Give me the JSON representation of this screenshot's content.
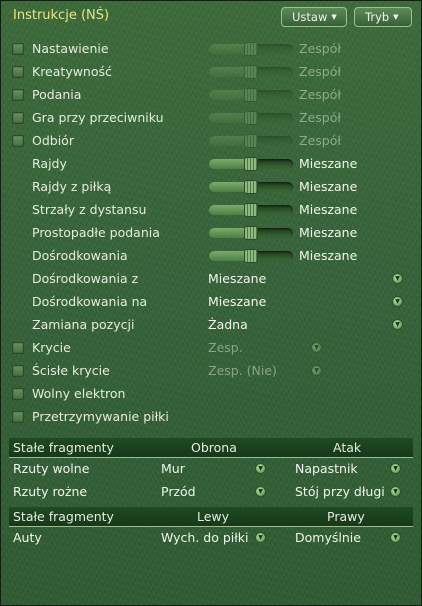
{
  "title": "Instrukcje (NŚ)",
  "buttons": {
    "set": "Ustaw",
    "mode": "Tryb"
  },
  "slider_rows": [
    {
      "label": "Nastawienie",
      "value": "Zespół",
      "level": 0.5,
      "enabled": false,
      "checkbox": true
    },
    {
      "label": "Kreatywność",
      "value": "Zespół",
      "level": 0.5,
      "enabled": false,
      "checkbox": true
    },
    {
      "label": "Podania",
      "value": "Zespół",
      "level": 0.5,
      "enabled": false,
      "checkbox": true
    },
    {
      "label": "Gra przy przeciwniku",
      "value": "Zespół",
      "level": 0.5,
      "enabled": false,
      "checkbox": true
    },
    {
      "label": "Odbiór",
      "value": "Zespół",
      "level": 0.5,
      "enabled": false,
      "checkbox": true
    },
    {
      "label": "Rajdy",
      "value": "Mieszane",
      "level": 0.5,
      "enabled": true,
      "checkbox": false
    },
    {
      "label": "Rajdy z piłką",
      "value": "Mieszane",
      "level": 0.5,
      "enabled": true,
      "checkbox": false
    },
    {
      "label": "Strzały z dystansu",
      "value": "Mieszane",
      "level": 0.5,
      "enabled": true,
      "checkbox": false
    },
    {
      "label": "Prostopadłe podania",
      "value": "Mieszane",
      "level": 0.5,
      "enabled": true,
      "checkbox": false
    },
    {
      "label": "Dośrodkowania",
      "value": "Mieszane",
      "level": 0.5,
      "enabled": true,
      "checkbox": false
    }
  ],
  "dropdown_rows": [
    {
      "label": "Dośrodkowania z",
      "value": "Mieszane"
    },
    {
      "label": "Dośrodkowania na",
      "value": "Mieszane"
    },
    {
      "label": "Zamiana pozycji",
      "value": "Żadna"
    }
  ],
  "check_dropdown_rows": [
    {
      "label": "Krycie",
      "value": "Zesp."
    },
    {
      "label": "Ścisłe krycie",
      "value": "Zesp. (Nie)"
    }
  ],
  "check_rows": [
    {
      "label": "Wolny elektron"
    },
    {
      "label": "Przetrzymywanie piłki"
    }
  ],
  "set_pieces_1": {
    "header": [
      "Stałe fragmenty",
      "Obrona",
      "Atak"
    ],
    "rows": [
      {
        "label": "Rzuty wolne",
        "defense": "Mur",
        "attack": "Napastnik"
      },
      {
        "label": "Rzuty rożne",
        "defense": "Przód",
        "attack": "Stój przy długi"
      }
    ]
  },
  "set_pieces_2": {
    "header": [
      "Stałe fragmenty",
      "Lewy",
      "Prawy"
    ],
    "rows": [
      {
        "label": "Auty",
        "left": "Wych. do piłki",
        "right": "Domyślnie"
      }
    ]
  }
}
